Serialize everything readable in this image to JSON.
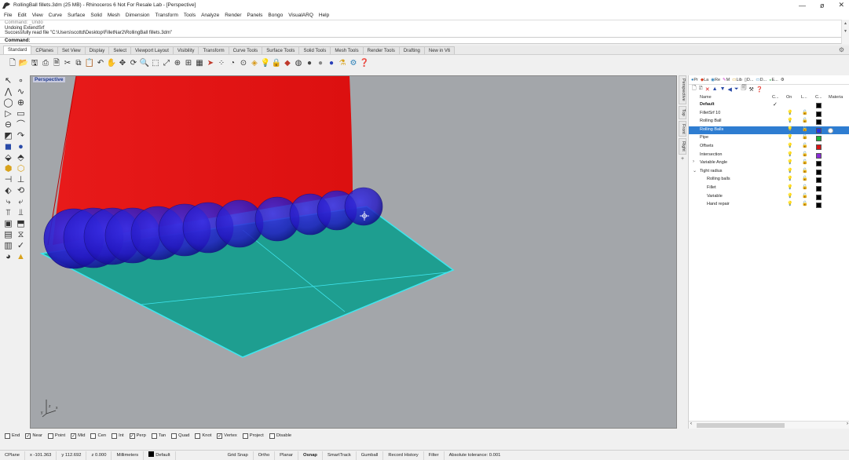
{
  "window": {
    "title": "RollingBall fillets.3dm (25 MB) - Rhinoceros 6 Not For Resale Lab - [Perspective]",
    "controls": [
      "—",
      "ø",
      "✕"
    ]
  },
  "menu": [
    "File",
    "Edit",
    "View",
    "Curve",
    "Surface",
    "Solid",
    "Mesh",
    "Dimension",
    "Transform",
    "Tools",
    "Analyze",
    "Render",
    "Panels",
    "Bongo",
    "VisualARQ",
    "Help"
  ],
  "command": {
    "history": [
      "Command: _Undo",
      "Undoing ExtendSrf",
      "Successfully read file \"C:\\Users\\scottd\\Desktop\\FilletNar2\\RollingBall fillets.3dm\""
    ],
    "prompt": "Command:"
  },
  "toolbar_tabs": [
    "Standard",
    "CPlanes",
    "Set View",
    "Display",
    "Select",
    "Viewport Layout",
    "Visibility",
    "Transform",
    "Curve Tools",
    "Surface Tools",
    "Solid Tools",
    "Mesh Tools",
    "Render Tools",
    "Drafting",
    "New in V6"
  ],
  "active_tab": "Standard",
  "viewport": {
    "label": "Perspective",
    "background": "#a3a6aa",
    "surface_red": "#e41515",
    "surface_teal": "#1e9e90",
    "edge_cyan": "#3fe6ef",
    "sphere_blue": "#2a24c8"
  },
  "viewport_tabs": [
    "Perspective",
    "Top",
    "Front",
    "Right"
  ],
  "panel": {
    "tabs": [
      "Pr",
      "La",
      "Re",
      "M",
      "Lib",
      "D...",
      "D...",
      "E..."
    ],
    "columns": {
      "name": "Name",
      "current": "C...",
      "on": "On",
      "lock": "L...",
      "color": "C...",
      "material": "Materia"
    },
    "layers": [
      {
        "name": "Default",
        "level": 0,
        "bold": true,
        "current": true,
        "color": "#000000",
        "expander": ""
      },
      {
        "name": "FilletSrf 10",
        "level": 0,
        "color": "#000000",
        "expander": ""
      },
      {
        "name": "Rolling Ball",
        "level": 0,
        "color": "#000000",
        "expander": ""
      },
      {
        "name": "Rolling Balls",
        "level": 0,
        "color": "#2433e6",
        "selected": true,
        "expander": ""
      },
      {
        "name": "Pipe",
        "level": 0,
        "color": "#1db43a",
        "expander": ""
      },
      {
        "name": "Offsets",
        "level": 0,
        "color": "#d91414",
        "expander": ""
      },
      {
        "name": "Intersection",
        "level": 0,
        "color": "#8a2bd6",
        "expander": ""
      },
      {
        "name": "Variable Angle",
        "level": 0,
        "color": "#000000",
        "expander": ">"
      },
      {
        "name": "Tight radius",
        "level": 0,
        "color": "#000000",
        "expander": "v"
      },
      {
        "name": "Rolling balls",
        "level": 1,
        "color": "#000000",
        "expander": ""
      },
      {
        "name": "Fillet",
        "level": 1,
        "color": "#000000",
        "expander": ""
      },
      {
        "name": "Variable",
        "level": 1,
        "color": "#000000",
        "expander": ""
      },
      {
        "name": "Hand repair",
        "level": 1,
        "color": "#000000",
        "expander": ""
      }
    ]
  },
  "osnaps": [
    {
      "label": "End",
      "checked": false
    },
    {
      "label": "Near",
      "checked": true
    },
    {
      "label": "Point",
      "checked": false
    },
    {
      "label": "Mid",
      "checked": true
    },
    {
      "label": "Cen",
      "checked": false
    },
    {
      "label": "Int",
      "checked": false
    },
    {
      "label": "Perp",
      "checked": true
    },
    {
      "label": "Tan",
      "checked": false
    },
    {
      "label": "Quad",
      "checked": false
    },
    {
      "label": "Knot",
      "checked": false
    },
    {
      "label": "Vertex",
      "checked": true
    },
    {
      "label": "Project",
      "checked": false
    },
    {
      "label": "Disable",
      "checked": false
    }
  ],
  "status": {
    "cplane": "CPlane",
    "x": "x -101.363",
    "y": "y 112.692",
    "z": "z 0.000",
    "units": "Millimeters",
    "layer": "Default",
    "toggles": [
      "Grid Snap",
      "Ortho",
      "Planar",
      "Osnap",
      "SmartTrack",
      "Gumball",
      "Record History",
      "Filter"
    ],
    "bold_toggles": [
      "Osnap"
    ],
    "tolerance": "Absolute tolerance: 0.001"
  }
}
